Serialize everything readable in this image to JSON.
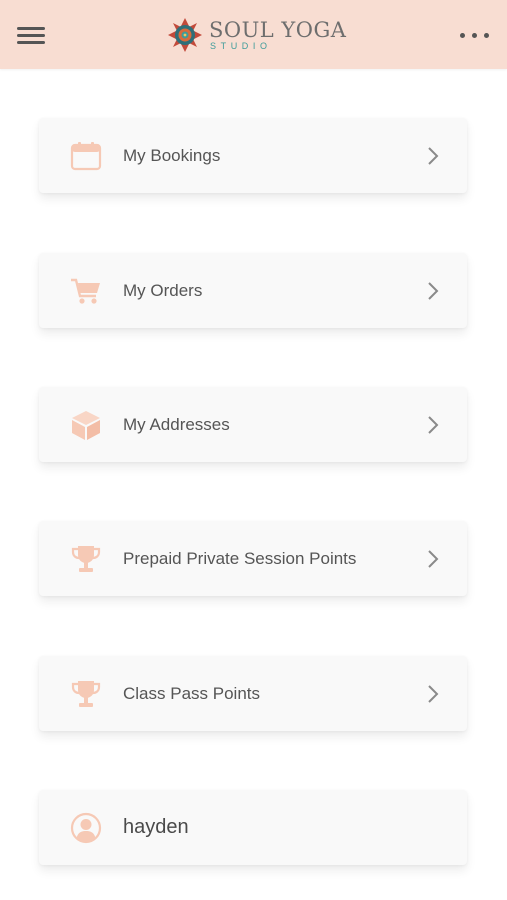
{
  "header": {
    "brand_title": "SOUL YOGA",
    "brand_subtitle": "STUDIO"
  },
  "menu_items": [
    {
      "label": "My Bookings",
      "icon": "calendar-icon"
    },
    {
      "label": "My Orders",
      "icon": "cart-icon"
    },
    {
      "label": "My Addresses",
      "icon": "box-icon"
    },
    {
      "label": "Prepaid Private Session Points",
      "icon": "trophy-icon"
    },
    {
      "label": "Class Pass Points",
      "icon": "trophy-icon"
    }
  ],
  "user": {
    "name": "hayden",
    "icon": "user-avatar-icon"
  },
  "colors": {
    "header_bg": "#f8ddd2",
    "icon_accent": "#f6c9b5",
    "brand_teal": "#3f9c9a",
    "text": "#555555"
  }
}
